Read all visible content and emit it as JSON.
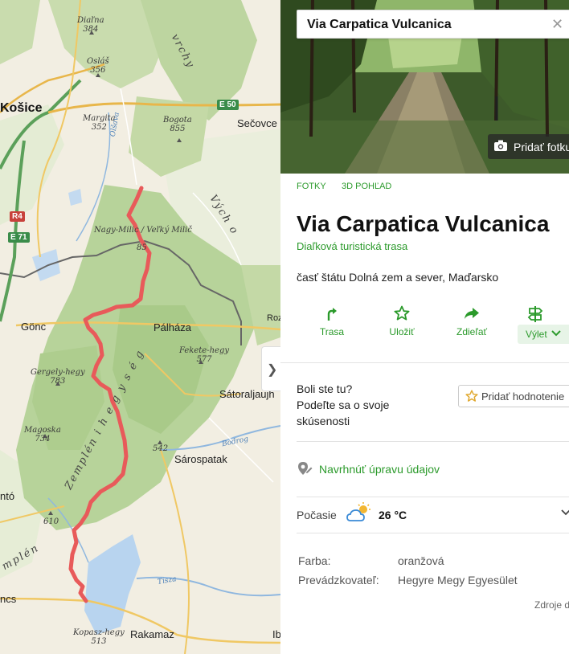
{
  "map": {
    "towns": {
      "kosice": "Košice",
      "secovce": "Sečovce",
      "goncz": "Gönc",
      "palhaza": "Pálháza",
      "satoraljaujhely": "Sátoraljaujh",
      "sarospatak": "Sárospatak",
      "rakamaz": "Rakamaz",
      "nagy_milic": "Nagy-Milic / Veľký Milič",
      "tokaj_cut": "ntó",
      "encs_cut": "ncs",
      "roz_cut": "Roz",
      "ib_cut": "Ib"
    },
    "peaks": [
      {
        "name": "Diaľna",
        "height": "384"
      },
      {
        "name": "Osláš",
        "height": "356"
      },
      {
        "name": "Margita",
        "height": "352"
      },
      {
        "name": "Bogota",
        "height": "855"
      },
      {
        "name": "Fekete-hegy",
        "height": "577"
      },
      {
        "name": "Gergely-hegy",
        "height": "783"
      },
      {
        "name": "Magoska",
        "height": "734"
      },
      {
        "name": "",
        "height": "542"
      },
      {
        "name": "",
        "height": "610"
      },
      {
        "name": "Kopasz-hegy",
        "height": "513"
      },
      {
        "name": "",
        "height": "85"
      }
    ],
    "regions": {
      "vrchy": "vrchy",
      "vychod": "Vých o",
      "zemplen": "Zemplén i  h e g y s é g",
      "mplen": "mplén"
    },
    "roads": {
      "e50": "E 50",
      "r4": "R4",
      "e71": "E 71"
    },
    "water": {
      "bodrog": "Bodrog",
      "tisza": "Tisza",
      "olsava": "Olšava"
    },
    "collapse_glyph": "❯",
    "route_color": "#e85a5a"
  },
  "panel": {
    "search": {
      "value": "Via Carpatica Vulcanica",
      "close": "✕"
    },
    "photo": {
      "add_label": "Pridať fotku"
    },
    "tabs": [
      "FOTKY",
      "3D POHĽAD"
    ],
    "title": "Via Carpatica Vulcanica",
    "subtitle": "Diaľková turistická trasa",
    "location": "časť štátu Dolná zem a sever, Maďarsko",
    "actions": {
      "route": "Trasa",
      "save": "Uložiť",
      "share": "Zdieľať",
      "trip": "Výlet"
    },
    "review": {
      "prompt_line1": "Boli ste tu?",
      "prompt_line2": "Podeľte sa o svoje",
      "prompt_line3": "skúsenosti",
      "button": "Pridať hodnotenie"
    },
    "suggest": "Navrhnúť úpravu údajov",
    "weather": {
      "label": "Počasie",
      "temp": "26 °C"
    },
    "properties": [
      {
        "key": "Farba:",
        "value": "oranžová"
      },
      {
        "key": "Prevádzkovateľ:",
        "value": "Hegyre Megy Egyesület"
      }
    ],
    "sources": "Zdroje d",
    "accent": "#2b9a2b"
  }
}
